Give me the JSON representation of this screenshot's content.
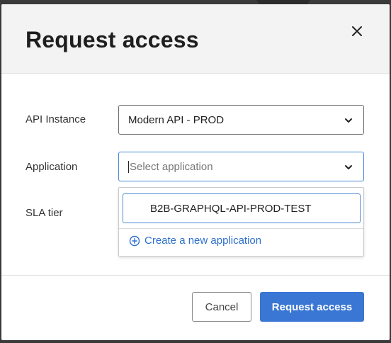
{
  "modal": {
    "title": "Request access"
  },
  "form": {
    "api_instance": {
      "label": "API Instance",
      "value": "Modern API - PROD"
    },
    "application": {
      "label": "Application",
      "placeholder": "Select application",
      "options": [
        "B2B-GRAPHQL-API-PROD-TEST"
      ],
      "create_link": "Create a new application"
    },
    "sla_tier": {
      "label": "SLA tier"
    }
  },
  "footer": {
    "cancel_label": "Cancel",
    "submit_label": "Request access"
  },
  "icons": {
    "close": "close-icon",
    "caret": "chevron-down-icon",
    "add": "plus-circle-icon"
  },
  "colors": {
    "accent": "#3a76d3",
    "link": "#2e6fcc",
    "focus_border": "#4a88d6"
  }
}
